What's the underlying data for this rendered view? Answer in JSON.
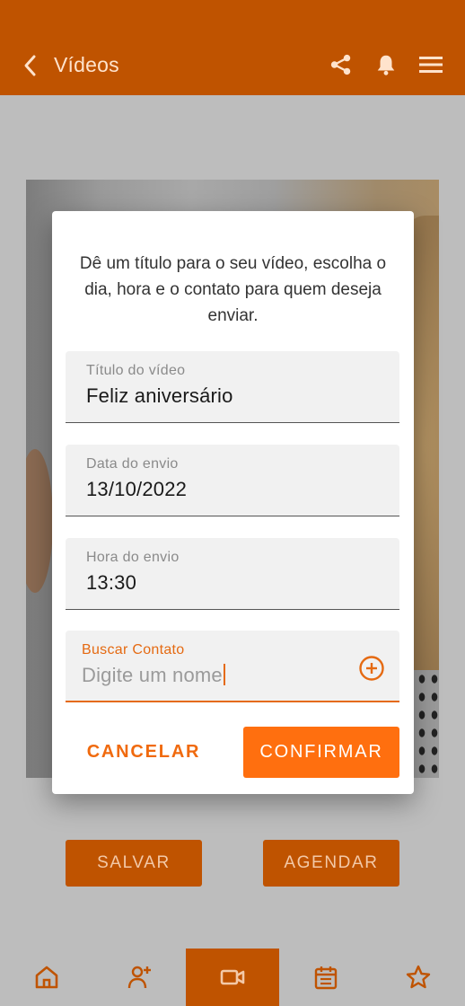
{
  "header": {
    "title": "Vídeos"
  },
  "actions": {
    "save_label": "SALVAR",
    "schedule_label": "AGENDAR"
  },
  "dialog": {
    "message": "Dê um título para o seu vídeo, escolha o dia, hora e o contato para quem deseja enviar.",
    "fields": [
      {
        "label": "Título do vídeo",
        "value": "Feliz aniversário"
      },
      {
        "label": "Data do envio",
        "value": "13/10/2022"
      },
      {
        "label": "Hora do envio",
        "value": "13:30"
      },
      {
        "label": "Buscar Contato",
        "placeholder": "Digite um nome"
      }
    ],
    "cancel_label": "CANCELAR",
    "confirm_label": "CONFIRMAR"
  },
  "bottom_nav": {
    "items": [
      {
        "icon": "home-icon",
        "active": false
      },
      {
        "icon": "add-person-icon",
        "active": false
      },
      {
        "icon": "video-camera-icon",
        "active": true
      },
      {
        "icon": "calendar-icon",
        "active": false
      },
      {
        "icon": "star-icon",
        "active": false
      }
    ]
  },
  "colors": {
    "primary": "#bf5300",
    "accent": "#ff6f0f",
    "overlay_bg": "#bdbdbd"
  }
}
